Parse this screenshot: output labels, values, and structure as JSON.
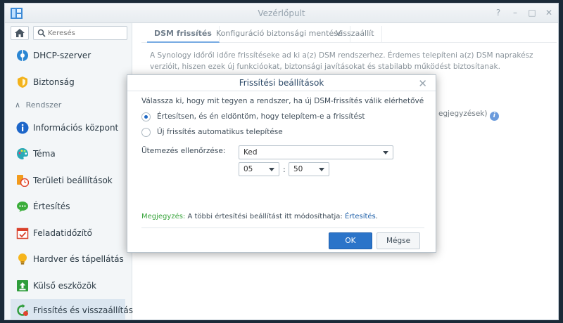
{
  "window": {
    "title": "Vezérlőpult",
    "controls": [
      "?",
      "–",
      "□",
      "✕"
    ]
  },
  "sidebar": {
    "search_placeholder": "Keresés",
    "section_label": "Rendszer",
    "items": [
      {
        "label": "DHCP-szerver",
        "icon": "dhcp-icon"
      },
      {
        "label": "Biztonság",
        "icon": "shield-icon"
      },
      {
        "label": "Információs központ",
        "icon": "info-icon"
      },
      {
        "label": "Téma",
        "icon": "palette-icon"
      },
      {
        "label": "Területi beállítások",
        "icon": "regional-clock-icon"
      },
      {
        "label": "Értesítés",
        "icon": "chat-bubble-icon"
      },
      {
        "label": "Feladatidőzítő",
        "icon": "calendar-check-icon"
      },
      {
        "label": "Hardver és tápellátás",
        "icon": "lightbulb-icon"
      },
      {
        "label": "Külső eszközök",
        "icon": "upload-box-icon"
      },
      {
        "label": "Frissítés és visszaállítás",
        "icon": "refresh-icon",
        "active": true
      }
    ]
  },
  "tabs": [
    {
      "label": "DSM frissítés",
      "active": true
    },
    {
      "label": "Konfiguráció biztonsági mentése"
    },
    {
      "label": "Visszaállít"
    }
  ],
  "main": {
    "description": "A Synology időről időre frissítéseke ad ki a(z) DSM rendszerhez. Érdemes telepíteni a(z) DSM naprakész verzióit, hiszen ezek új funkcióokat, biztonsági javításokat és stabilabb működést biztosítanak.",
    "partial_link": "egjegyzések",
    "partial_suffix": ")"
  },
  "dialog": {
    "title": "Frissítési beállítások",
    "question": "Válassza ki, hogy mit tegyen a rendszer, ha új DSM-frissítés válik elérhetővé",
    "options": [
      {
        "label": "Értesítsen, és én eldöntöm, hogy telepítem-e a frissítést",
        "selected": true
      },
      {
        "label": "Új frissítés automatikus telepítése",
        "selected": false
      }
    ],
    "schedule_label": "Ütemezés ellenőrzése:",
    "day_value": "Ked",
    "hour_value": "05",
    "minute_value": "50",
    "time_separator": ":",
    "note_prefix": "Megjegyzés:",
    "note_text": "A többi értesítési beállítást itt módosíthatja:",
    "note_link": "Értesítés",
    "note_suffix": ".",
    "ok_label": "OK",
    "cancel_label": "Mégse"
  },
  "colors": {
    "accent": "#2b74c9",
    "note_green": "#36a33a",
    "active_nav": "#dbe6f0"
  }
}
